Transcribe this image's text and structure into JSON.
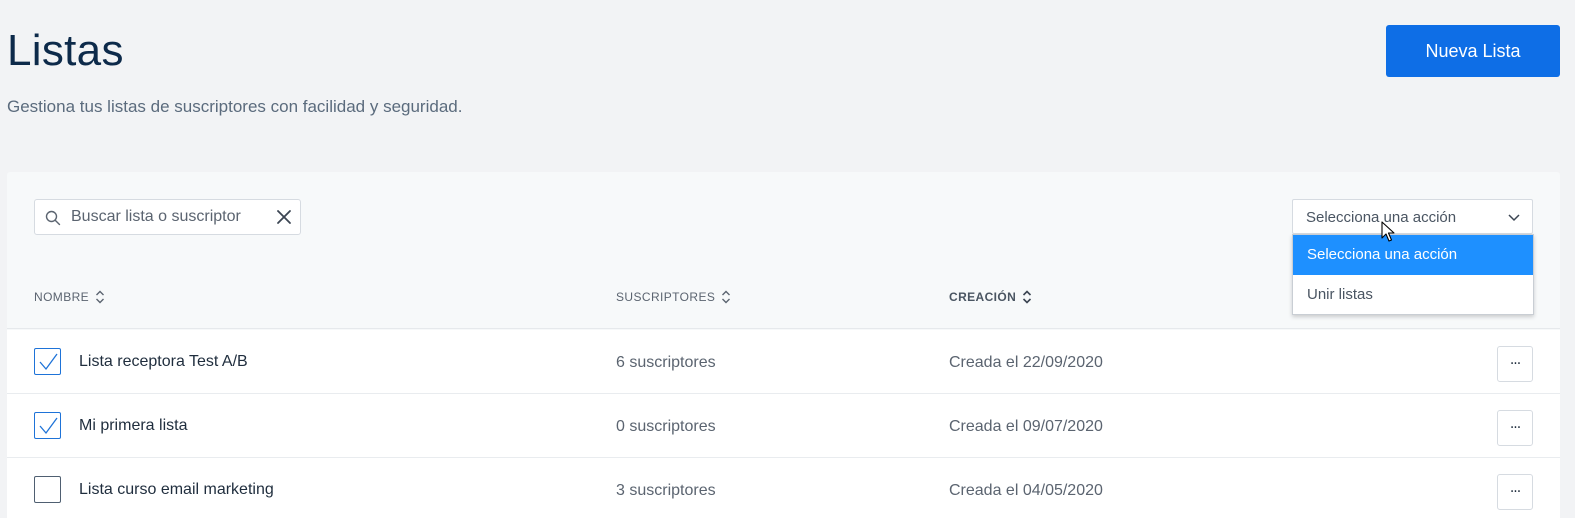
{
  "header": {
    "title": "Listas",
    "subtitle": "Gestiona tus listas de suscriptores con facilidad y seguridad.",
    "new_button_label": "Nueva Lista"
  },
  "search": {
    "placeholder": "Buscar lista o suscriptor",
    "value": ""
  },
  "actions": {
    "selected_label": "Selecciona una acción",
    "options": [
      {
        "label": "Selecciona una acción",
        "selected": true
      },
      {
        "label": "Unir listas",
        "selected": false
      }
    ]
  },
  "table": {
    "columns": [
      "NOMBRE",
      "SUSCRIPTORES",
      "CREACIÓN"
    ],
    "rows": [
      {
        "name": "Lista receptora Test A/B",
        "subscribers": "6 suscriptores",
        "created": "Creada el 22/09/2020",
        "checked": true
      },
      {
        "name": "Mi primera lista",
        "subscribers": "0 suscriptores",
        "created": "Creada el 09/07/2020",
        "checked": true
      },
      {
        "name": "Lista curso email marketing",
        "subscribers": "3 suscriptores",
        "created": "Creada el 04/05/2020",
        "checked": false
      }
    ],
    "more_label": "···"
  },
  "colors": {
    "primary": "#0e6ee6",
    "dropdown_selected": "#1e90ff",
    "title": "#0d2a4a"
  },
  "icons": {
    "search": "search-icon",
    "clear": "close-icon",
    "dropdown": "chevron-down-icon",
    "sort": "sort-icon",
    "check": "check-icon",
    "more": "more-icon"
  }
}
